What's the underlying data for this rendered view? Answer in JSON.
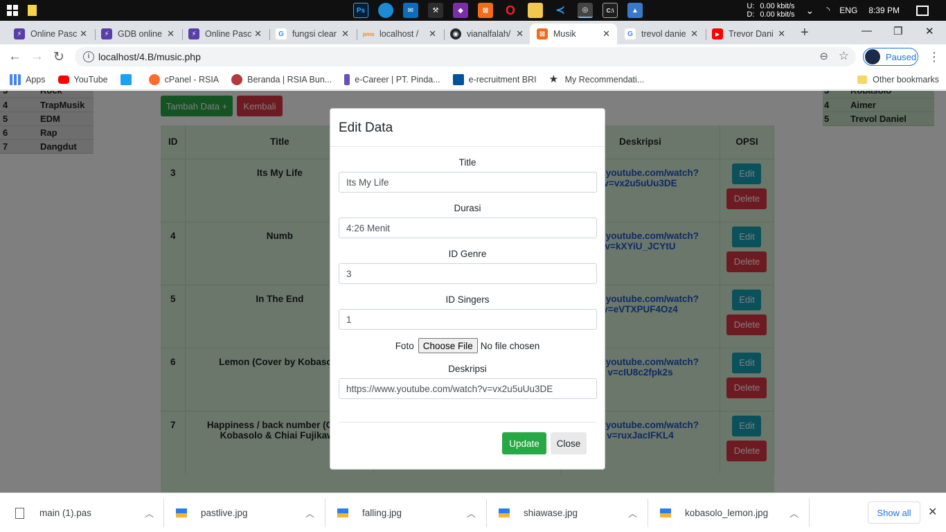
{
  "taskbar": {
    "net_up_label": "U:",
    "net_up": "0.00 kbit/s",
    "net_down_label": "D:",
    "net_down": "0.00 kbit/s",
    "language": "ENG",
    "time": "8:39 PM"
  },
  "tabs": [
    {
      "label": "Online Pasc",
      "color": "#5a3ea8",
      "glyph": "⚡"
    },
    {
      "label": "GDB online",
      "color": "#5a3ea8",
      "glyph": "⚡"
    },
    {
      "label": "Online Pasc",
      "color": "#5a3ea8",
      "glyph": "⚡"
    },
    {
      "label": "fungsi clear",
      "color": "#4285f4",
      "glyph": "G"
    },
    {
      "label": "localhost /",
      "color": "#f08a24",
      "glyph": "pma"
    },
    {
      "label": "vianalfalah/",
      "color": "#24292e",
      "glyph": "◉"
    },
    {
      "label": "Musik",
      "color": "#f26b1d",
      "glyph": "⊠"
    },
    {
      "label": "trevol danie",
      "color": "#4285f4",
      "glyph": "G"
    },
    {
      "label": "Trevor Dani",
      "color": "#ff0000",
      "glyph": "▶"
    }
  ],
  "address": {
    "url": "localhost/4.B/music.php",
    "profile_label": "Paused"
  },
  "bookmarks": [
    {
      "label": "Apps",
      "color": "#4285f4"
    },
    {
      "label": "YouTube",
      "color": "#ff0000"
    },
    {
      "label": "",
      "color": "#1da1f2"
    },
    {
      "label": "cPanel - RSIA",
      "color": "#ff6c2c"
    },
    {
      "label": "Beranda | RSIA Bun...",
      "color": "#b23a3a"
    },
    {
      "label": "e-Career | PT. Pinda...",
      "color": "#6b4fbb"
    },
    {
      "label": "e-recruitment BRI",
      "color": "#00529c"
    },
    {
      "label": "My Recommendati...",
      "color": "#333333"
    }
  ],
  "other_bookmarks": "Other bookmarks",
  "genres": [
    {
      "id": "3",
      "name": "Rock"
    },
    {
      "id": "4",
      "name": "TrapMusik"
    },
    {
      "id": "5",
      "name": "EDM"
    },
    {
      "id": "6",
      "name": "Rap"
    },
    {
      "id": "7",
      "name": "Dangdut"
    }
  ],
  "singers": [
    {
      "id": "3",
      "name": "Kobasolo"
    },
    {
      "id": "4",
      "name": "Aimer"
    },
    {
      "id": "5",
      "name": "Trevol Daniel"
    }
  ],
  "page": {
    "tambah_label": "Tambah Data +",
    "kembali_label": "Kembali",
    "col_id": "ID",
    "col_title": "Title",
    "col_deskripsi": "Deskripsi",
    "col_opsi": "OPSI",
    "edit_label": "Edit",
    "delete_label": "Delete"
  },
  "rows": [
    {
      "id": "3",
      "title": "Its My Life",
      "desk": "www.youtube.com/watch?v=vx2u5uUu3DE"
    },
    {
      "id": "4",
      "title": "Numb",
      "desk": "www.youtube.com/watch?v=kXYiU_JCYtU"
    },
    {
      "id": "5",
      "title": "In The End",
      "desk": "www.youtube.com/watch?v=eVTXPUF4Oz4"
    },
    {
      "id": "6",
      "title": "Lemon (Cover by Kobasolo",
      "desk": "www.youtube.com/watch?v=cIU8c2fpk2s"
    },
    {
      "id": "7",
      "title": "Happiness / back number (Cover Kobasolo & Chiai Fujikawa",
      "desk": "www.youtube.com/watch?v=ruxJacIFKL4"
    }
  ],
  "modal": {
    "title": "Edit Data",
    "title_label": "Title",
    "title_value": "Its My Life",
    "durasi_label": "Durasi",
    "durasi_value": "4:26 Menit",
    "genre_label": "ID Genre",
    "genre_value": "3",
    "singers_label": "ID Singers",
    "singers_value": "1",
    "foto_label": "Foto",
    "choose_file": "Choose File",
    "no_file": "No file chosen",
    "deskripsi_label": "Deskripsi",
    "deskripsi_value": "https://www.youtube.com/watch?v=vx2u5uUu3DE",
    "update_label": "Update",
    "close_label": "Close"
  },
  "downloads": [
    {
      "name": "main (1).pas",
      "type": "doc"
    },
    {
      "name": "pastlive.jpg",
      "type": "img"
    },
    {
      "name": "falling.jpg",
      "type": "img"
    },
    {
      "name": "shiawase.jpg",
      "type": "img"
    },
    {
      "name": "kobasolo_lemon.jpg",
      "type": "img"
    }
  ],
  "show_all": "Show all"
}
